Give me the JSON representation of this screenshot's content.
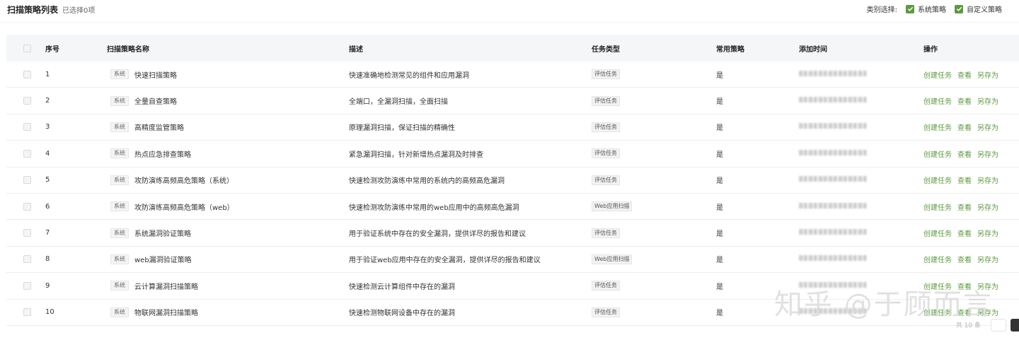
{
  "header": {
    "title": "扫描策略列表",
    "selected_count": "已选择0项",
    "filter_label": "类别选择:",
    "filter_options": [
      "系统策略",
      "自定义策略"
    ]
  },
  "table": {
    "columns": [
      "序号",
      "扫描策略名称",
      "描述",
      "任务类型",
      "常用策略",
      "添加时间",
      "操作"
    ],
    "rows": [
      {
        "no": "1",
        "tag": "系统",
        "name": "快速扫描策略",
        "desc": "快速准确地检测常见的组件和应用漏洞",
        "type": "评估任务",
        "common": "是"
      },
      {
        "no": "2",
        "tag": "系统",
        "name": "全量自查策略",
        "desc": "全端口，全漏洞扫描，全面扫描",
        "type": "评估任务",
        "common": "是"
      },
      {
        "no": "3",
        "tag": "系统",
        "name": "高精度监管策略",
        "desc": "原理漏洞扫描，保证扫描的精确性",
        "type": "评估任务",
        "common": "是"
      },
      {
        "no": "4",
        "tag": "系统",
        "name": "热点应急排查策略",
        "desc": "紧急漏洞扫描，针对新增热点漏洞及时排查",
        "type": "评估任务",
        "common": "是"
      },
      {
        "no": "5",
        "tag": "系统",
        "name": "攻防演练高频高危策略（系统）",
        "desc": "快速检测攻防演练中常用的系统内的高频高危漏洞",
        "type": "评估任务",
        "common": "是"
      },
      {
        "no": "6",
        "tag": "系统",
        "name": "攻防演练高频高危策略（web）",
        "desc": "快速检测攻防演练中常用的web应用中的高频高危漏洞",
        "type": "Web应用扫描",
        "common": "是"
      },
      {
        "no": "7",
        "tag": "系统",
        "name": "系统漏洞验证策略",
        "desc": "用于验证系统中存在的安全漏洞，提供详尽的报告和建议",
        "type": "评估任务",
        "common": "是"
      },
      {
        "no": "8",
        "tag": "系统",
        "name": "web漏洞验证策略",
        "desc": "用于验证web应用中存在的安全漏洞，提供详尽的报告和建议",
        "type": "Web应用扫描",
        "common": "是"
      },
      {
        "no": "9",
        "tag": "系统",
        "name": "云计算漏洞扫描策略",
        "desc": "快速检测云计算组件中存在的漏洞",
        "type": "评估任务",
        "common": "是"
      },
      {
        "no": "10",
        "tag": "系统",
        "name": "物联网漏洞扫描策略",
        "desc": "快速检测物联网设备中存在的漏洞",
        "type": "评估任务",
        "common": "是"
      }
    ],
    "actions": [
      "创建任务",
      "查看",
      "另存为"
    ]
  },
  "watermark": "知乎 @于顾而言",
  "colors": {
    "accent": "#5b9a3e",
    "header_bg": "#f5f6f8"
  }
}
